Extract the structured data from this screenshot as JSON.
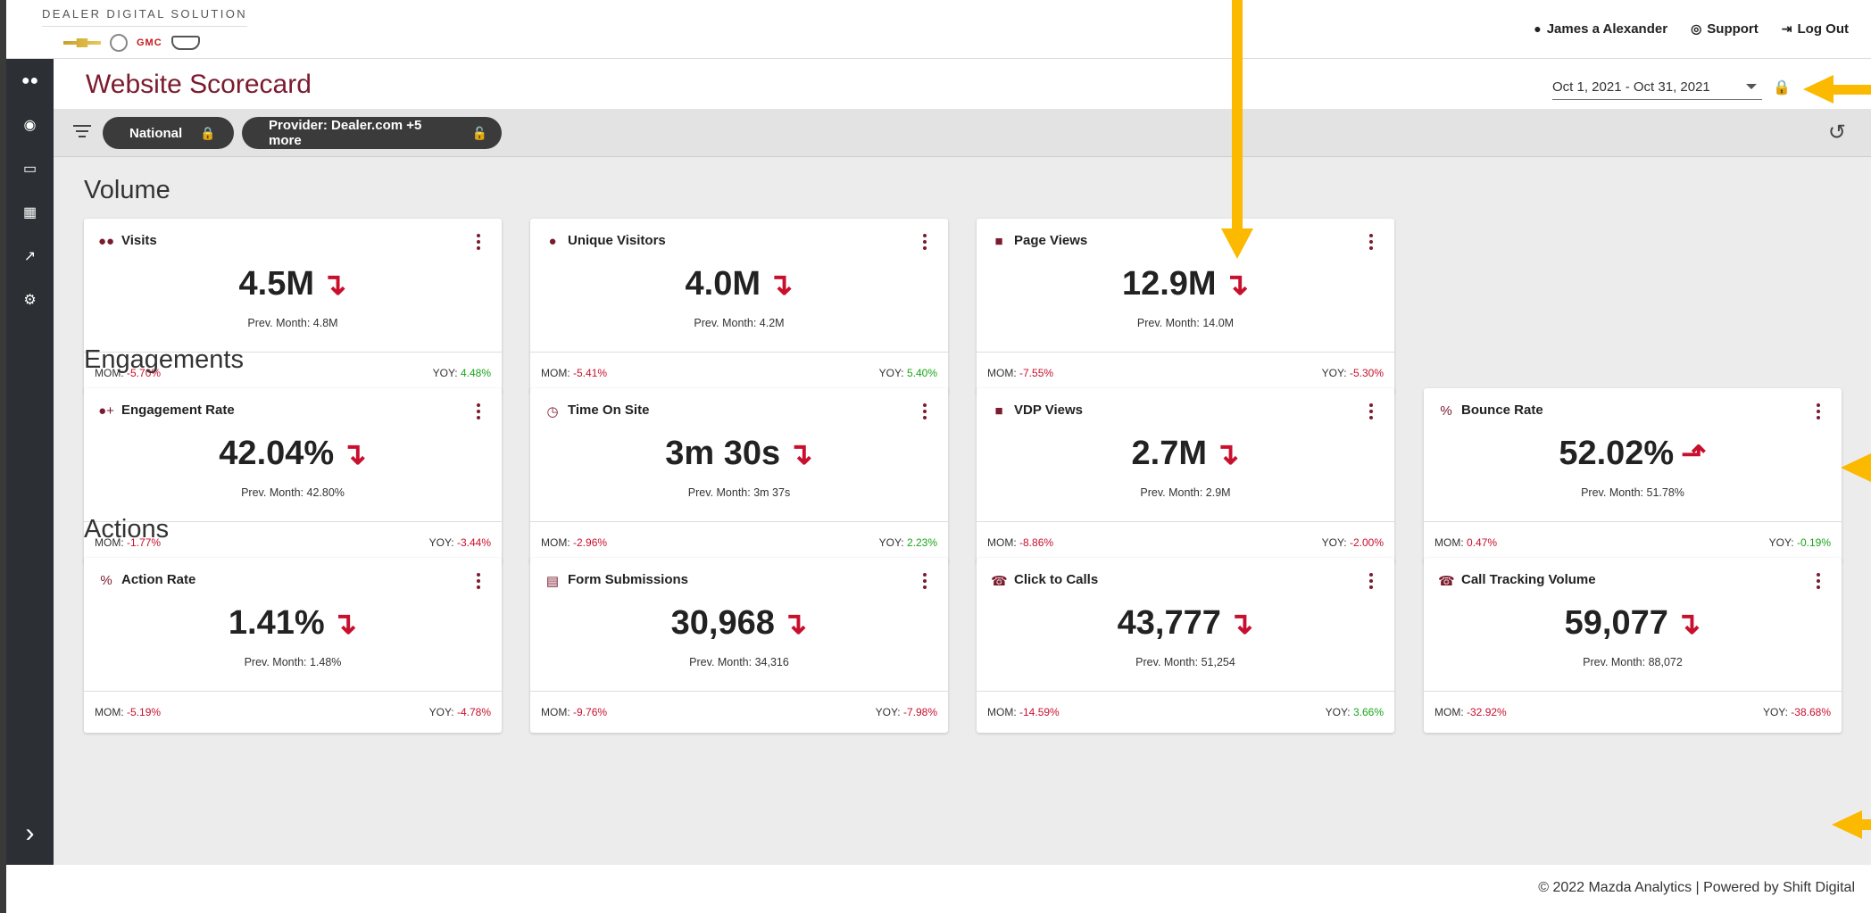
{
  "brand": {
    "title": "DEALER DIGITAL SOLUTION",
    "gmc_logo": "GMC"
  },
  "user_nav": {
    "user": "James a Alexander",
    "support": "Support",
    "logout": "Log Out"
  },
  "sidebar": {
    "icons": [
      "users-icon",
      "globe-icon",
      "monitor-icon",
      "building-icon",
      "external-link-icon",
      "gear-icon"
    ]
  },
  "page": {
    "title": "Website Scorecard",
    "date_range": "Oct 1, 2021 - Oct 31, 2021"
  },
  "filters": {
    "chips": [
      {
        "label": "National"
      },
      {
        "label": "Provider: Dealer.com +5 more"
      }
    ]
  },
  "sections": [
    {
      "title": "Volume",
      "cards": [
        {
          "title": "Visits",
          "icon": "users-icon",
          "value": "4.5M",
          "trend": "down",
          "prev": "Prev. Month: 4.8M",
          "mom_label": "MOM:",
          "mom": "-5.70%",
          "mom_color": "#c8102e",
          "yoy_label": "YOY:",
          "yoy": "4.48%",
          "yoy_color": "#1aa51a"
        },
        {
          "title": "Unique Visitors",
          "icon": "user-icon",
          "value": "4.0M",
          "trend": "down",
          "prev": "Prev. Month: 4.2M",
          "mom_label": "MOM:",
          "mom": "-5.41%",
          "mom_color": "#c8102e",
          "yoy_label": "YOY:",
          "yoy": "5.40%",
          "yoy_color": "#1aa51a"
        },
        {
          "title": "Page Views",
          "icon": "file-icon",
          "value": "12.9M",
          "trend": "down",
          "prev": "Prev. Month: 14.0M",
          "mom_label": "MOM:",
          "mom": "-7.55%",
          "mom_color": "#c8102e",
          "yoy_label": "YOY:",
          "yoy": "-5.30%",
          "yoy_color": "#c8102e"
        }
      ]
    },
    {
      "title": "Engagements",
      "cards": [
        {
          "title": "Engagement Rate",
          "icon": "user-plus-icon",
          "value": "42.04%",
          "trend": "down",
          "prev": "Prev. Month: 42.80%",
          "mom_label": "MOM:",
          "mom": "-1.77%",
          "mom_color": "#c8102e",
          "yoy_label": "YOY:",
          "yoy": "-3.44%",
          "yoy_color": "#c8102e"
        },
        {
          "title": "Time On Site",
          "icon": "clock-icon",
          "value": "3m 30s",
          "trend": "down",
          "prev": "Prev. Month: 3m 37s",
          "mom_label": "MOM:",
          "mom": "-2.96%",
          "mom_color": "#c8102e",
          "yoy_label": "YOY:",
          "yoy": "2.23%",
          "yoy_color": "#1aa51a"
        },
        {
          "title": "VDP Views",
          "icon": "file-icon",
          "value": "2.7M",
          "trend": "down",
          "prev": "Prev. Month: 2.9M",
          "mom_label": "MOM:",
          "mom": "-8.86%",
          "mom_color": "#c8102e",
          "yoy_label": "YOY:",
          "yoy": "-2.00%",
          "yoy_color": "#c8102e"
        },
        {
          "title": "Bounce Rate",
          "icon": "percent-icon",
          "value": "52.02%",
          "trend": "up",
          "prev": "Prev. Month: 51.78%",
          "mom_label": "MOM:",
          "mom": "0.47%",
          "mom_color": "#c8102e",
          "yoy_label": "YOY:",
          "yoy": "-0.19%",
          "yoy_color": "#1aa51a"
        }
      ]
    },
    {
      "title": "Actions",
      "cards": [
        {
          "title": "Action Rate",
          "icon": "percent-icon",
          "value": "1.41%",
          "trend": "down",
          "prev": "Prev. Month: 1.48%",
          "mom_label": "MOM:",
          "mom": "-5.19%",
          "mom_color": "#c8102e",
          "yoy_label": "YOY:",
          "yoy": "-4.78%",
          "yoy_color": "#c8102e"
        },
        {
          "title": "Form Submissions",
          "icon": "form-icon",
          "value": "30,968",
          "trend": "down",
          "prev": "Prev. Month: 34,316",
          "mom_label": "MOM:",
          "mom": "-9.76%",
          "mom_color": "#c8102e",
          "yoy_label": "YOY:",
          "yoy": "-7.98%",
          "yoy_color": "#c8102e"
        },
        {
          "title": "Click to Calls",
          "icon": "phone-icon",
          "value": "43,777",
          "trend": "down",
          "prev": "Prev. Month: 51,254",
          "mom_label": "MOM:",
          "mom": "-14.59%",
          "mom_color": "#c8102e",
          "yoy_label": "YOY:",
          "yoy": "3.66%",
          "yoy_color": "#1aa51a"
        },
        {
          "title": "Call Tracking Volume",
          "icon": "phone-icon",
          "value": "59,077",
          "trend": "down",
          "prev": "Prev. Month: 88,072",
          "mom_label": "MOM:",
          "mom": "-32.92%",
          "mom_color": "#c8102e",
          "yoy_label": "YOY:",
          "yoy": "-38.68%",
          "yoy_color": "#c8102e"
        }
      ]
    }
  ],
  "footer": {
    "text": "© 2022 Mazda Analytics | Powered by Shift Digital"
  },
  "colors": {
    "brand": "#7b1b2e",
    "negative": "#c8102e",
    "positive": "#1aa51a",
    "lock": "#f1a900",
    "annotation": "#fbb900"
  }
}
